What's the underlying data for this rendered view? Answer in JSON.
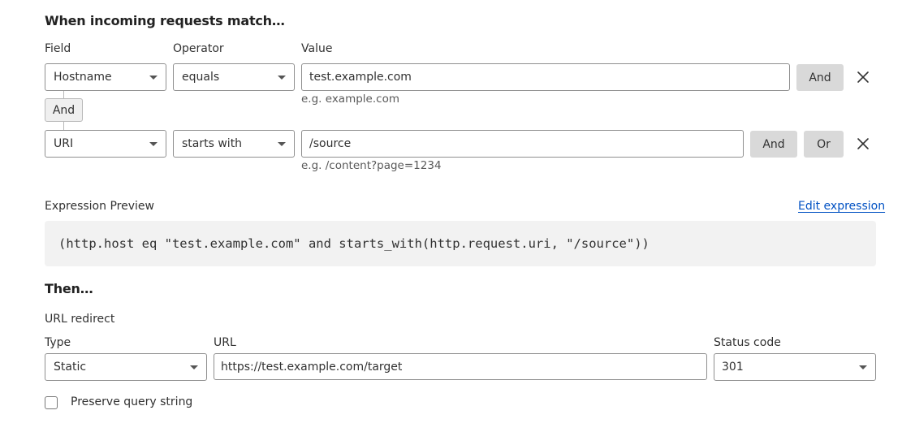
{
  "match_section": {
    "heading": "When incoming requests match…",
    "columns": {
      "field": "Field",
      "operator": "Operator",
      "value": "Value"
    },
    "rows": [
      {
        "field": "Hostname",
        "operator": "equals",
        "value": "test.example.com",
        "hint": "e.g. example.com",
        "buttons": [
          "And"
        ]
      },
      {
        "field": "URI",
        "operator": "starts with",
        "value": "/source",
        "hint": "e.g. /content?page=1234",
        "buttons": [
          "And",
          "Or"
        ]
      }
    ],
    "connector_label": "And"
  },
  "expression": {
    "label": "Expression Preview",
    "edit_link": "Edit expression",
    "code": "(http.host eq \"test.example.com\" and starts_with(http.request.uri, \"/source\"))"
  },
  "then_section": {
    "heading": "Then…",
    "action_label": "URL redirect",
    "type_label": "Type",
    "type_value": "Static",
    "url_label": "URL",
    "url_value": "https://test.example.com/target",
    "status_label": "Status code",
    "status_value": "301",
    "preserve_label": "Preserve query string",
    "preserve_checked": false
  },
  "icons": {
    "remove": "close-icon",
    "dropdown": "chevron-down-icon"
  }
}
